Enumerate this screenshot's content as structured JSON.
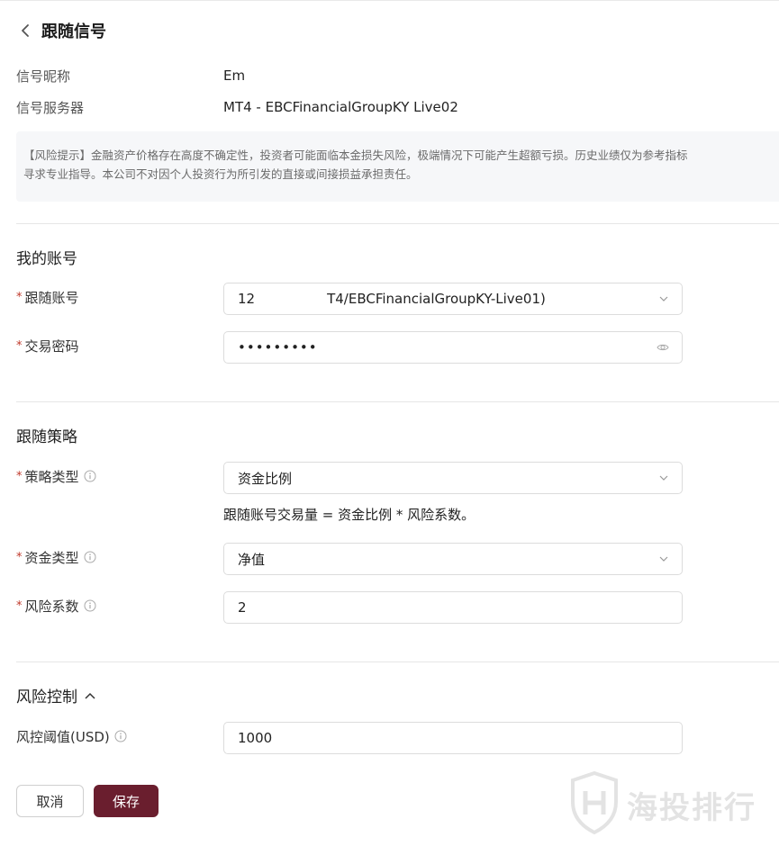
{
  "header": {
    "title": "跟随信号"
  },
  "signal": {
    "nickname_label": "信号昵称",
    "nickname_value": "Em",
    "server_label": "信号服务器",
    "server_value": "MT4 - EBCFinancialGroupKY Live02"
  },
  "notice": {
    "line1": "【风险提示】金融资产价格存在高度不确定性，投资者可能面临本金损失风险，极端情况下可能产生超额亏损。历史业绩仅为参考指标",
    "line2": "寻求专业指导。本公司不对因个人投资行为所引发的直接或间接损益承担责任。"
  },
  "my_account": {
    "section_title": "我的账号",
    "follow_account_label": "跟随账号",
    "follow_account_value_prefix": "12",
    "follow_account_value_suffix": "T4/EBCFinancialGroupKY-Live01)",
    "password_label": "交易密码",
    "password_value": "•••••••••"
  },
  "strategy": {
    "section_title": "跟随策略",
    "type_label": "策略类型",
    "type_value": "资金比例",
    "type_hint": "跟随账号交易量 = 资金比例 * 风险系数。",
    "fund_type_label": "资金类型",
    "fund_type_value": "净值",
    "risk_factor_label": "风险系数",
    "risk_factor_value": "2"
  },
  "risk_control": {
    "section_title": "风险控制",
    "threshold_label": "风控阈值(USD)",
    "threshold_value": "1000"
  },
  "actions": {
    "cancel_label": "取消",
    "save_label": "保存"
  },
  "watermark": {
    "text": "海投排行"
  },
  "colors": {
    "primary": "#6a1e2e",
    "required": "#c0392b",
    "notice_bg": "#f6f7f9"
  },
  "icons": {
    "back": "chevron-left-icon",
    "dropdown": "chevron-down-icon",
    "password_toggle": "eye-icon",
    "help": "info-circle-icon",
    "collapse": "chevron-up-icon",
    "watermark_logo": "shield-icon"
  }
}
